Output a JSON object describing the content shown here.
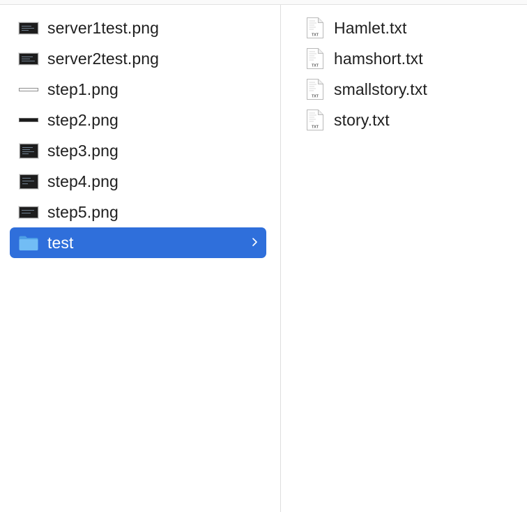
{
  "left_column": {
    "items": [
      {
        "label": "server1test.png",
        "icon": "image-thumbnail-icon"
      },
      {
        "label": "server2test.png",
        "icon": "image-thumbnail-icon"
      },
      {
        "label": "step1.png",
        "icon": "image-thumbnail-icon"
      },
      {
        "label": "step2.png",
        "icon": "image-thumbnail-icon"
      },
      {
        "label": "step3.png",
        "icon": "image-thumbnail-icon"
      },
      {
        "label": "step4.png",
        "icon": "image-thumbnail-icon"
      },
      {
        "label": "step5.png",
        "icon": "image-thumbnail-icon"
      },
      {
        "label": "test",
        "icon": "folder-icon",
        "selected": true
      }
    ]
  },
  "right_column": {
    "items": [
      {
        "label": "Hamlet.txt",
        "icon": "text-file-icon"
      },
      {
        "label": "hamshort.txt",
        "icon": "text-file-icon"
      },
      {
        "label": "smallstory.txt",
        "icon": "text-file-icon"
      },
      {
        "label": "story.txt",
        "icon": "text-file-icon"
      }
    ],
    "file_icon_badge": "TXT"
  },
  "colors": {
    "selection": "#2f6fdb",
    "folder": "#62b2f0"
  }
}
